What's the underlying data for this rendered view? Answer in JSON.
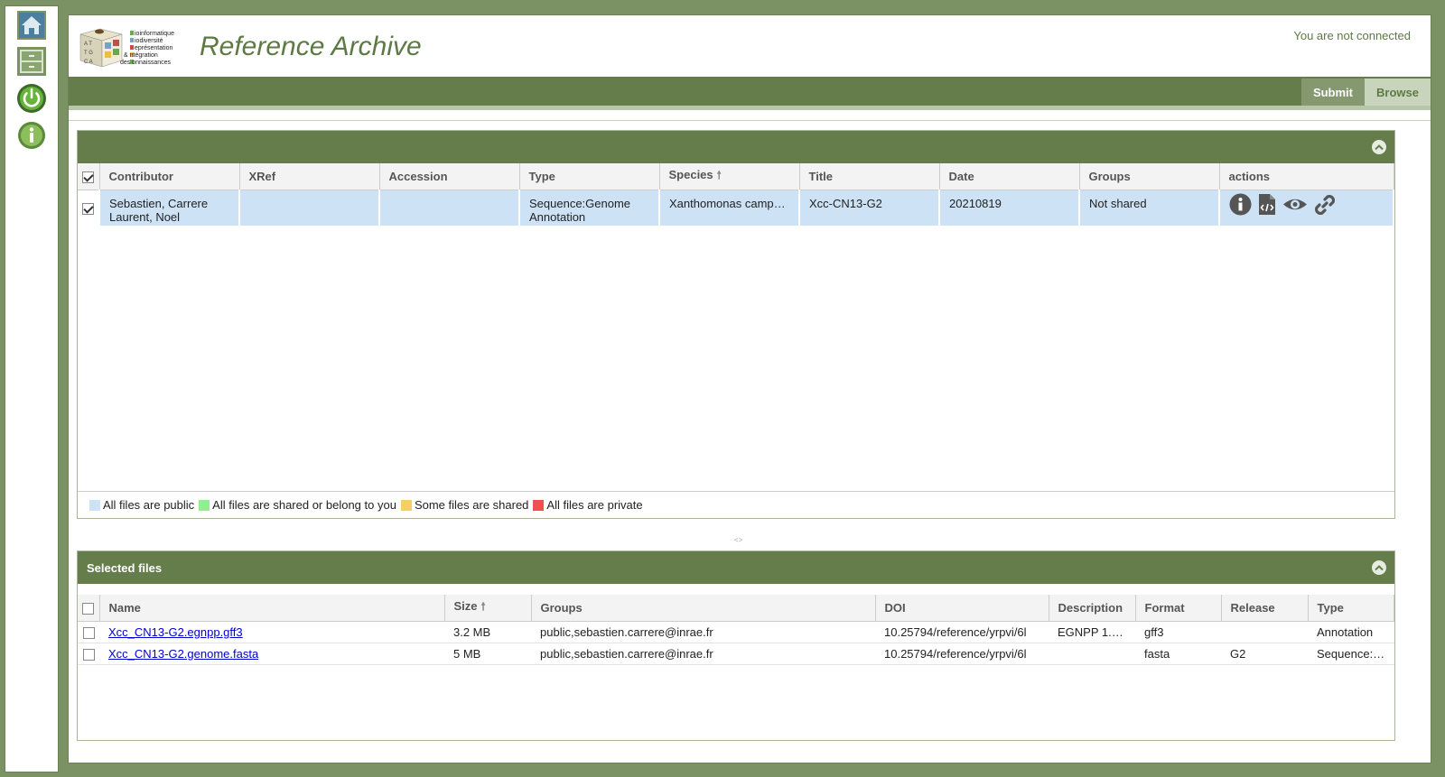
{
  "header": {
    "logo_text_lines": [
      "ioinformatique",
      "iodiversité",
      "eprésentation",
      "&  ntégration",
      "des  onnaissances"
    ],
    "app_title": "Reference Archive",
    "connection_status": "You are not connected"
  },
  "menu": {
    "submit_label": "Submit",
    "browse_label": "Browse"
  },
  "sidebar": {
    "items": [
      {
        "name": "home",
        "icon": "home-icon"
      },
      {
        "name": "archive",
        "icon": "archive-icon"
      },
      {
        "name": "power",
        "icon": "power-icon"
      },
      {
        "name": "info",
        "icon": "info-icon"
      }
    ]
  },
  "archives": {
    "columns": [
      "Contributor",
      "XRef",
      "Accession",
      "Type",
      "Species",
      "Title",
      "Date",
      "Groups",
      "actions"
    ],
    "rows": [
      {
        "contributor_line1": "Sebastien, Carrere",
        "contributor_line2": "Laurent, Noel",
        "xref": "",
        "accession": "",
        "type_line1": "Sequence:Genome",
        "type_line2": "Annotation",
        "species": "Xanthomonas campe…",
        "title": "Xcc-CN13-G2",
        "date": "20210819",
        "groups": "Not shared"
      }
    ],
    "legend": [
      {
        "label": "All files are public",
        "color": "#cde2f5"
      },
      {
        "label": "All files are shared or belong to you",
        "color": "#90ee90"
      },
      {
        "label": "Some files are shared",
        "color": "#f5d060"
      },
      {
        "label": "All files are private",
        "color": "#f05050"
      }
    ]
  },
  "files": {
    "panel_title": "Selected files",
    "columns": [
      "Name",
      "Size",
      "Groups",
      "DOI",
      "Description",
      "Format",
      "Release",
      "Type"
    ],
    "rows": [
      {
        "name": "Xcc_CN13-G2.egnpp.gff3",
        "size": "3.2 MB",
        "groups": "public,sebastien.carrere@inrae.fr",
        "doi": "10.25794/reference/yrpvi/6l",
        "description": "EGNPP 1.…",
        "format": "gff3",
        "release": "",
        "type": "Annotation"
      },
      {
        "name": "Xcc_CN13-G2.genome.fasta",
        "size": "5 MB",
        "groups": "public,sebastien.carrere@inrae.fr",
        "doi": "10.25794/reference/yrpvi/6l",
        "description": "",
        "format": "fasta",
        "release": "G2",
        "type": "Sequence:…"
      }
    ]
  },
  "colors": {
    "brand_green": "#647d4b",
    "selected_row": "#cde2f5"
  }
}
